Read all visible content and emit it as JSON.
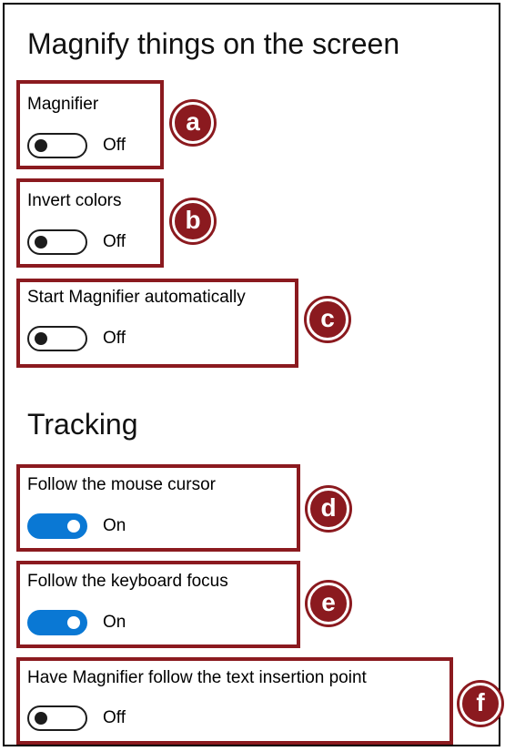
{
  "magnify_section": {
    "heading": "Magnify things on the screen",
    "settings": [
      {
        "label": "Magnifier",
        "state": "Off",
        "on": false,
        "marker": "a"
      },
      {
        "label": "Invert colors",
        "state": "Off",
        "on": false,
        "marker": "b"
      },
      {
        "label": "Start Magnifier automatically",
        "state": "Off",
        "on": false,
        "marker": "c"
      }
    ]
  },
  "tracking_section": {
    "heading": "Tracking",
    "settings": [
      {
        "label": "Follow the mouse cursor",
        "state": "On",
        "on": true,
        "marker": "d"
      },
      {
        "label": "Follow the keyboard focus",
        "state": "On",
        "on": true,
        "marker": "e"
      },
      {
        "label": "Have Magnifier follow the text insertion point",
        "state": "Off",
        "on": false,
        "marker": "f"
      }
    ]
  },
  "colors": {
    "annotation": "#8b1a1f",
    "toggle_on": "#0a78d4",
    "toggle_off": "#1c1c1c"
  }
}
